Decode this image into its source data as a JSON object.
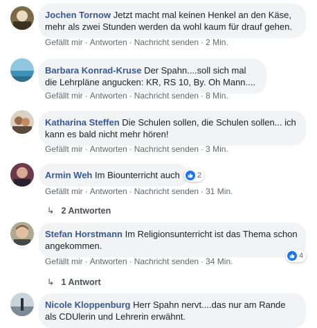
{
  "actions": {
    "like": "Gefällt mir",
    "reply": "Antworten",
    "message": "Nachricht senden",
    "separator": "·"
  },
  "comments": [
    {
      "author": "Jochen Tornow",
      "text": "Jetzt macht mal keinen Henkel an den Käse, mehr als zwei Stunden werden da wohl kaum für drauf gehen.",
      "time": "2 Min."
    },
    {
      "author": "Barbara Konrad-Kruse",
      "text": "Der Spahn....soll sich mal die Lehrpläne angucken: KR, RS 10, By. Oh Mann....",
      "time": "8 Min."
    },
    {
      "author": "Katharina Steffen",
      "text": "Die Schulen sollen, die Schulen sollen... ich kann es bald nicht mehr hören!",
      "time": "3 Min."
    },
    {
      "author": "Armin Weh",
      "text": "Im Biounterricht auch",
      "time": "31 Min.",
      "reactions": "2",
      "replies": "2 Antworten"
    },
    {
      "author": "Stefan Horstmann",
      "text": "Im Religionsunterricht ist das Thema schon angekommen.",
      "time": "34 Min.",
      "reactions": "4",
      "replies": "1 Antwort"
    },
    {
      "author": "Nicole Kloppenburg",
      "text": "Herr Spahn nervt....das nur am Rande als CDUlerin und Lehrerin erwähnt."
    }
  ],
  "colors": {
    "author": "#385898",
    "bubble": "#f2f3f5",
    "meta": "#606770",
    "like_blue": "#1877f2"
  }
}
